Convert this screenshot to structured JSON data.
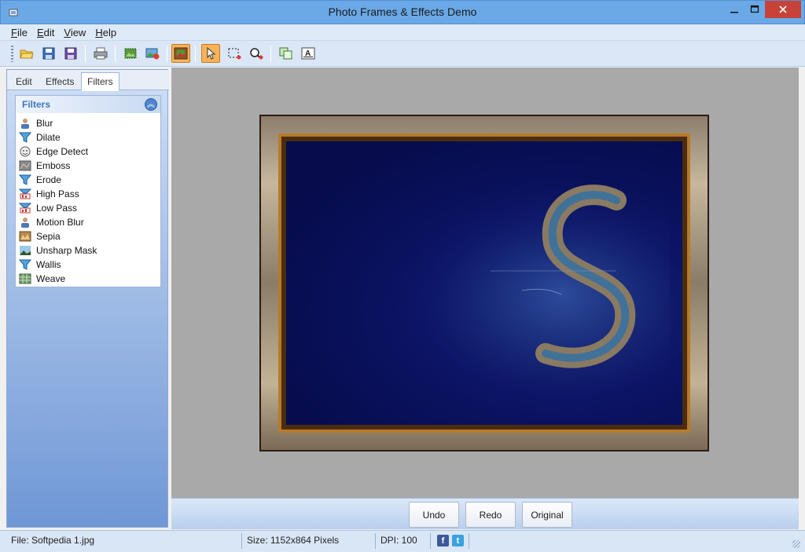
{
  "window": {
    "title": "Photo Frames & Effects Demo",
    "minimize_icon": "minimize-icon",
    "maximize_icon": "maximize-icon",
    "close_icon": "close-icon"
  },
  "menu": [
    {
      "label": "File",
      "accel": "F",
      "rest": "ile"
    },
    {
      "label": "Edit",
      "accel": "E",
      "rest": "dit"
    },
    {
      "label": "View",
      "accel": "V",
      "rest": "iew"
    },
    {
      "label": "Help",
      "accel": "H",
      "rest": "elp"
    }
  ],
  "toolbar": {
    "icons": [
      "open-icon",
      "save-icon",
      "save-as-icon",
      "print-icon",
      "crop-image-icon",
      "add-image-icon",
      "frame-icon",
      "pointer-icon",
      "select-rect-icon",
      "zoom-icon",
      "copy-icon",
      "text-icon"
    ],
    "active": [
      "frame-icon",
      "pointer-icon"
    ]
  },
  "left_panel": {
    "tabs": [
      "Edit",
      "Effects",
      "Filters"
    ],
    "active_tab": "Filters",
    "filters_header": "Filters",
    "filters": [
      {
        "label": "Blur",
        "icon": "person-blur-icon"
      },
      {
        "label": "Dilate",
        "icon": "funnel-icon"
      },
      {
        "label": "Edge Detect",
        "icon": "face-outline-icon"
      },
      {
        "label": "Emboss",
        "icon": "emboss-icon"
      },
      {
        "label": "Erode",
        "icon": "funnel-icon"
      },
      {
        "label": "High Pass",
        "icon": "funnel-bars-icon"
      },
      {
        "label": "Low Pass",
        "icon": "funnel-bars-icon"
      },
      {
        "label": "Motion Blur",
        "icon": "person-blur-icon"
      },
      {
        "label": "Sepia",
        "icon": "sepia-icon"
      },
      {
        "label": "Unsharp Mask",
        "icon": "landscape-icon"
      },
      {
        "label": "Wallis",
        "icon": "funnel-icon"
      },
      {
        "label": "Weave",
        "icon": "weave-icon"
      }
    ]
  },
  "actions": {
    "undo": "Undo",
    "redo": "Redo",
    "original": "Original"
  },
  "status": {
    "file": "File: Softpedia 1.jpg",
    "size": "Size: 1152x864 Pixels",
    "dpi": "DPI: 100",
    "facebook_icon": "f",
    "twitter_icon": "t"
  },
  "colors": {
    "titlebar": "#6aa9e6",
    "close_button": "#c7433a",
    "active_tool": "#f7b25a",
    "canvas": "#a9a9a9"
  }
}
